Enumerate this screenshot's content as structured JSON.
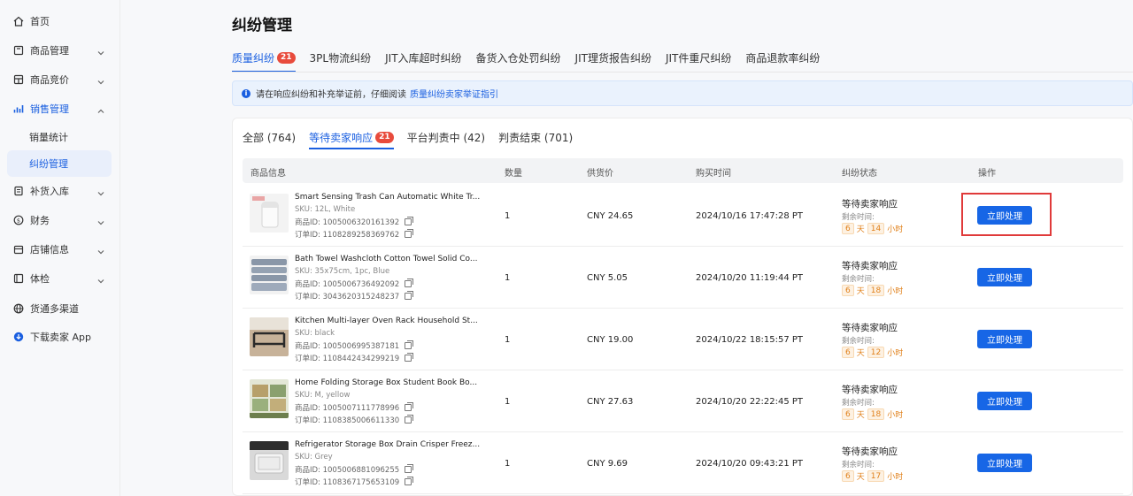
{
  "sidebar": {
    "items": [
      {
        "label": "首页",
        "icon": "home-icon"
      },
      {
        "label": "商品管理",
        "icon": "product-icon"
      },
      {
        "label": "商品竞价",
        "icon": "bid-icon"
      },
      {
        "label": "销售管理",
        "icon": "sales-icon"
      },
      {
        "label": "补货入库",
        "icon": "restock-icon"
      },
      {
        "label": "财务",
        "icon": "finance-icon"
      },
      {
        "label": "店铺信息",
        "icon": "shop-icon"
      },
      {
        "label": "体检",
        "icon": "checkup-icon"
      },
      {
        "label": "货通多渠道",
        "icon": "globe-icon"
      },
      {
        "label": "下载卖家 App",
        "icon": "download-icon"
      }
    ],
    "sub_items": [
      "销量统计",
      "纠纷管理"
    ]
  },
  "page": {
    "title": "纠纷管理",
    "tabs": [
      {
        "label": "质量纠纷",
        "badge": "21"
      },
      {
        "label": "3PL物流纠纷"
      },
      {
        "label": "JIT入库超时纠纷"
      },
      {
        "label": "备货入仓处罚纠纷"
      },
      {
        "label": "JIT理货报告纠纷"
      },
      {
        "label": "JIT件重尺纠纷"
      },
      {
        "label": "商品退款率纠纷"
      }
    ],
    "notice": {
      "text": "请在响应纠纷和补充举证前，仔细阅读",
      "link": "质量纠纷卖家举证指引"
    }
  },
  "sub_tabs": [
    {
      "label": "全部 (764)"
    },
    {
      "label": "等待卖家响应",
      "badge": "21"
    },
    {
      "label": "平台判责中 (42)"
    },
    {
      "label": "判责结束 (701)"
    }
  ],
  "table": {
    "headers": [
      "商品信息",
      "数量",
      "供货价",
      "购买时间",
      "纠纷状态",
      "操作"
    ],
    "remaining_label": "剩余时间:",
    "day_unit": "天",
    "hour_unit": "小时",
    "action_label": "立即处理",
    "rows": [
      {
        "title": "Smart Sensing Trash Can Automatic White Tr...",
        "sku": "SKU: 12L, White",
        "product_id": "商品ID: 1005006320161392",
        "order_id": "订单ID: 1108289258369762",
        "qty": "1",
        "price": "CNY 24.65",
        "time": "2024/10/16 17:47:28 PT",
        "status": "等待卖家响应",
        "days": "6",
        "hours": "14"
      },
      {
        "title": "Bath Towel Washcloth Cotton Towel Solid Co...",
        "sku": "SKU: 35x75cm, 1pc, Blue",
        "product_id": "商品ID: 1005006736492092",
        "order_id": "订单ID: 3043620315248237",
        "qty": "1",
        "price": "CNY 5.05",
        "time": "2024/10/20 11:19:44 PT",
        "status": "等待卖家响应",
        "days": "6",
        "hours": "18"
      },
      {
        "title": "Kitchen Multi-layer Oven Rack Household St...",
        "sku": "SKU: black",
        "product_id": "商品ID: 1005006995387181",
        "order_id": "订单ID: 1108442434299219",
        "qty": "1",
        "price": "CNY 19.00",
        "time": "2024/10/22 18:15:57 PT",
        "status": "等待卖家响应",
        "days": "6",
        "hours": "12"
      },
      {
        "title": "Home Folding Storage Box Student Book Bo...",
        "sku": "SKU: M, yellow",
        "product_id": "商品ID: 1005007111778996",
        "order_id": "订单ID: 1108385006611330",
        "qty": "1",
        "price": "CNY 27.63",
        "time": "2024/10/20 22:22:45 PT",
        "status": "等待卖家响应",
        "days": "6",
        "hours": "18"
      },
      {
        "title": "Refrigerator Storage Box Drain Crisper Freez...",
        "sku": "SKU: Grey",
        "product_id": "商品ID: 1005006881096255",
        "order_id": "订单ID: 1108367175653109",
        "qty": "1",
        "price": "CNY 9.69",
        "time": "2024/10/20 09:43:21 PT",
        "status": "等待卖家响应",
        "days": "6",
        "hours": "17"
      }
    ]
  },
  "colors": {
    "accent": "#1766e6",
    "badge": "#e84b3c",
    "countdown": "#e0801a",
    "highlight": "#e03a3a"
  }
}
